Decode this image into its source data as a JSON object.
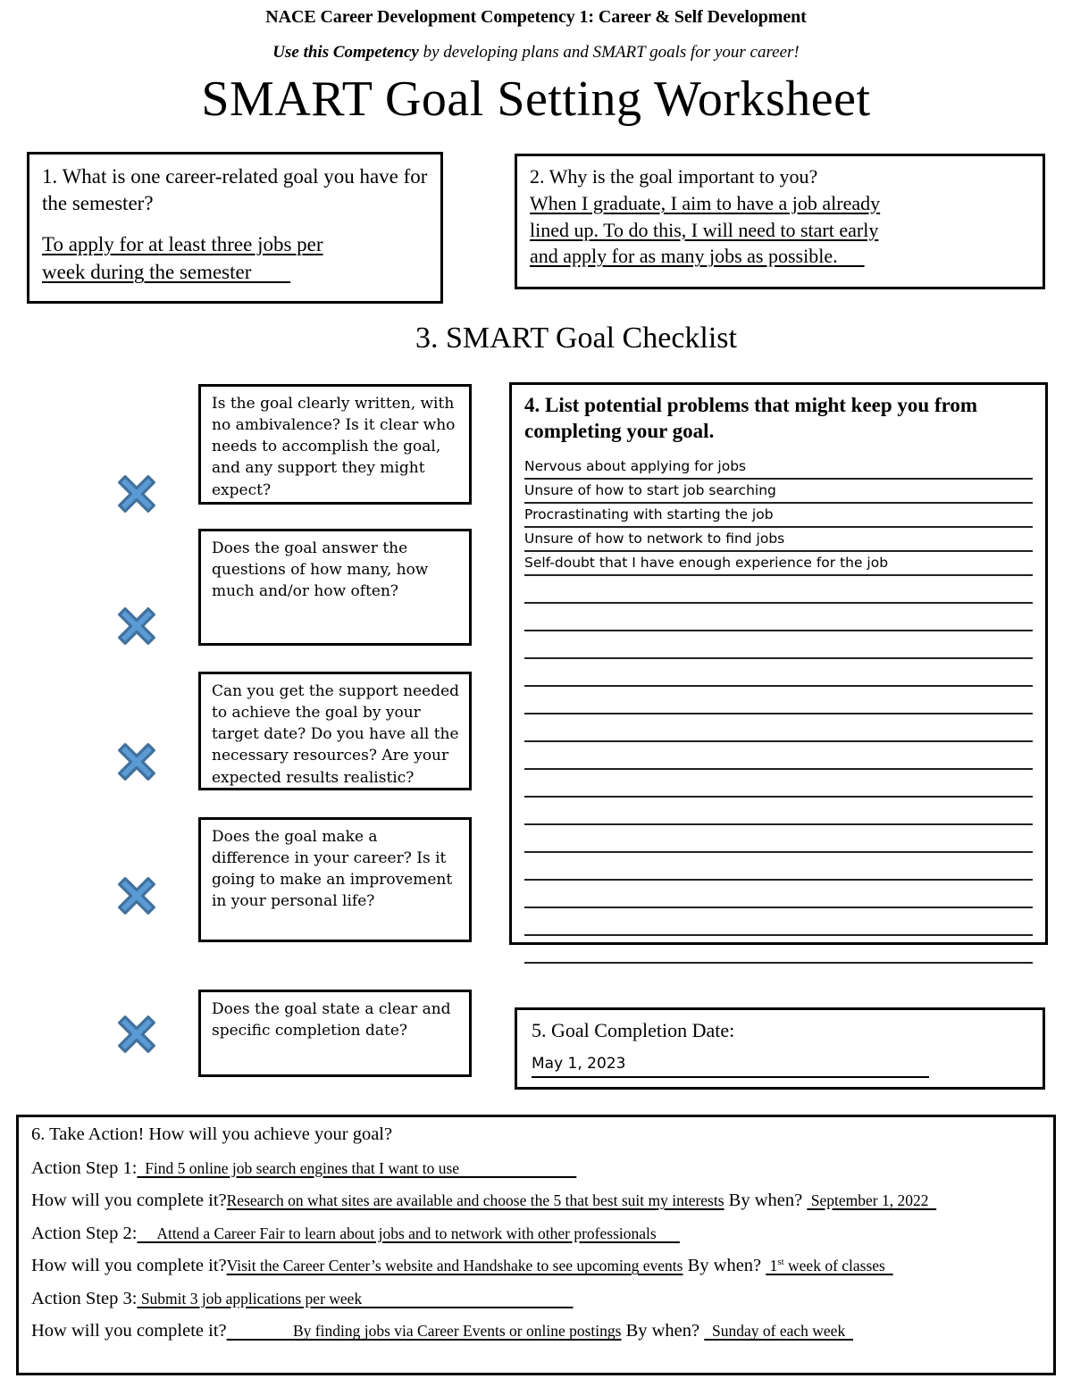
{
  "header": {
    "competency_line": "NACE Career Development Competency 1: Career & Self Development",
    "subtitle_bold": "Use this Competency",
    "subtitle_rest": " by developing plans and SMART goals for your career!",
    "title": "SMART Goal Setting Worksheet"
  },
  "q1": {
    "prompt": "1. What is one career-related goal you have for the semester?",
    "answer_line1": "To apply for at least three jobs per",
    "answer_line2": "week during the semester"
  },
  "q2": {
    "prompt": "2. Why is the goal important to you?",
    "answer_line1": "When I graduate, I aim to have a job already",
    "answer_line2": "lined up. To do this, I will need to start early",
    "answer_line3": "and apply for as many jobs as possible."
  },
  "section3": {
    "title": "3. SMART Goal Checklist",
    "items": [
      {
        "icon": "blue-x-icon",
        "text": "Is the goal clearly written, with no ambivalence? Is it clear who needs to accomplish the goal, and any support they might expect?"
      },
      {
        "icon": "blue-x-icon",
        "text": "Does the goal answer the questions of how many, how much and/or how often?"
      },
      {
        "icon": "blue-x-icon",
        "text": "Can you get the support needed to achieve the goal by your target date? Do you have all the necessary resources? Are your expected results realistic?"
      },
      {
        "icon": "blue-x-icon",
        "text": "Does the goal make a difference in your career? Is it going to make an improvement in your personal life?"
      },
      {
        "icon": "blue-x-icon",
        "text": "Does the goal state a clear and specific completion date?"
      }
    ]
  },
  "q4": {
    "prompt": "4. List potential problems that might keep you from completing your goal.",
    "filled_lines": [
      "Nervous about applying for jobs",
      "Unsure of how to start job searching",
      "Procrastinating with starting the job",
      "Unsure of how to network to find jobs",
      "Self-doubt that I have enough experience for the job"
    ],
    "empty_line_count": 14
  },
  "q5": {
    "label": "5. Goal Completion Date:",
    "value": "May 1, 2023"
  },
  "q6": {
    "prompt": "6. Take Action! How will you achieve your goal?",
    "step_label_1": "Action Step 1:",
    "step_label_2": "Action Step 2:",
    "step_label_3": "Action Step 3:",
    "how_label": "How will you complete it?",
    "by_when_label": "By when?",
    "steps": [
      {
        "step_value": "Find 5 online job search engines that I want to use",
        "how_value": "Research on what sites are available and choose the 5 that best suit my interests",
        "when_value": "September 1, 2022",
        "when_sup": ""
      },
      {
        "step_value": "Attend a Career Fair to learn about jobs and to network with other professionals",
        "how_value": "Visit the Career Center’s website and Handshake to see upcoming events",
        "when_value": "1",
        "when_sup": "st",
        "when_tail": " week of classes"
      },
      {
        "step_value": "Submit 3 job applications per week",
        "how_value": "By finding jobs via Career Events or online postings",
        "when_value": "Sunday of each week",
        "when_sup": ""
      }
    ]
  },
  "colors": {
    "icon_fill": "#5b9bd5",
    "icon_stroke": "#41719c",
    "border": "#000000",
    "rule": "#222222"
  }
}
